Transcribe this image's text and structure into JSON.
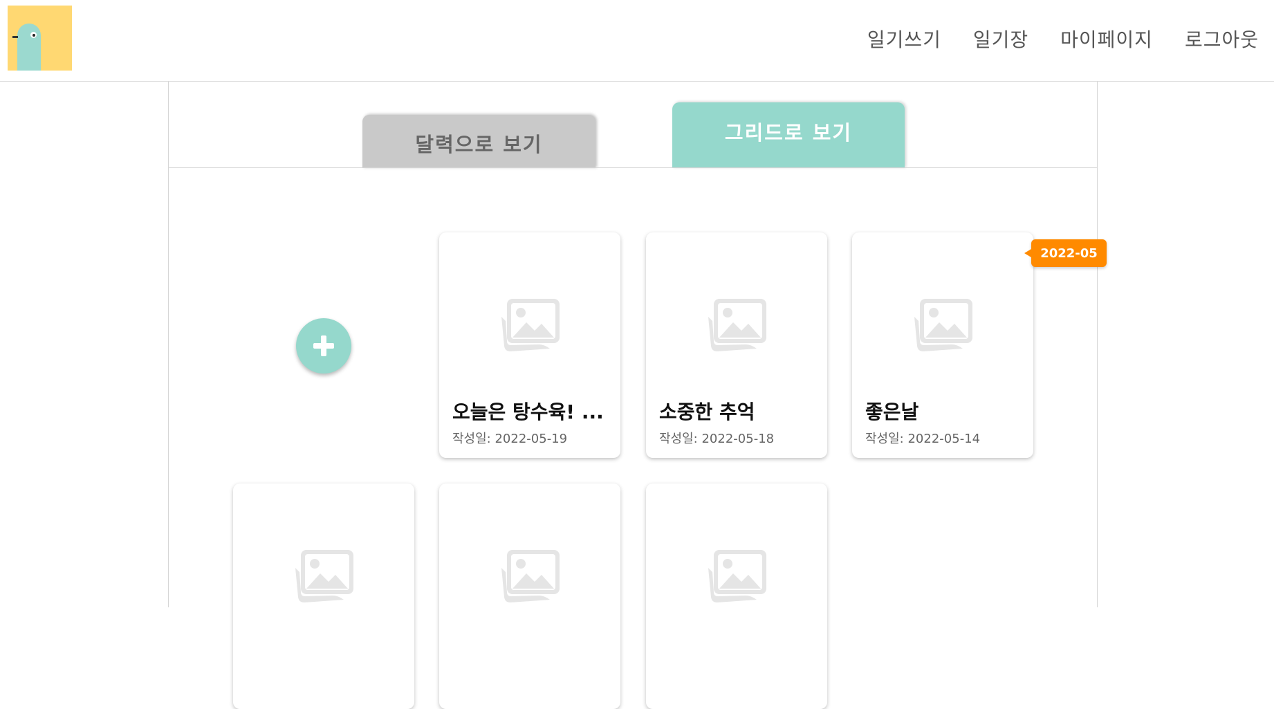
{
  "header": {
    "logo_label": "",
    "nav": [
      {
        "label": "일기쓰기"
      },
      {
        "label": "일기장"
      },
      {
        "label": "마이페이지"
      },
      {
        "label": "로그아웃"
      }
    ]
  },
  "tabs": [
    {
      "label": "달력으로 보기",
      "active": false
    },
    {
      "label": "그리드로 보기",
      "active": true
    }
  ],
  "colors": {
    "accent": "#95d8cc",
    "logo_bg": "#ffd872",
    "badge": "#ff8a00",
    "inactive_tab": "#c9c9c9"
  },
  "add_button": {
    "icon": "plus-icon"
  },
  "month_badge": "2022-05",
  "cards": [
    {
      "title": "오늘은 탕수육! ...",
      "date_label": "작성일:",
      "date": "2022-05-19",
      "icon": "image-placeholder-icon"
    },
    {
      "title": "소중한 추억",
      "date_label": "작성일:",
      "date": "2022-05-18",
      "icon": "image-placeholder-icon"
    },
    {
      "title": "좋은날",
      "date_label": "작성일:",
      "date": "2022-05-14",
      "icon": "image-placeholder-icon"
    },
    {
      "title": "",
      "date_label": "",
      "date": "",
      "icon": "image-placeholder-icon"
    },
    {
      "title": "",
      "date_label": "",
      "date": "",
      "icon": "image-placeholder-icon"
    },
    {
      "title": "",
      "date_label": "",
      "date": "",
      "icon": "image-placeholder-icon"
    }
  ]
}
